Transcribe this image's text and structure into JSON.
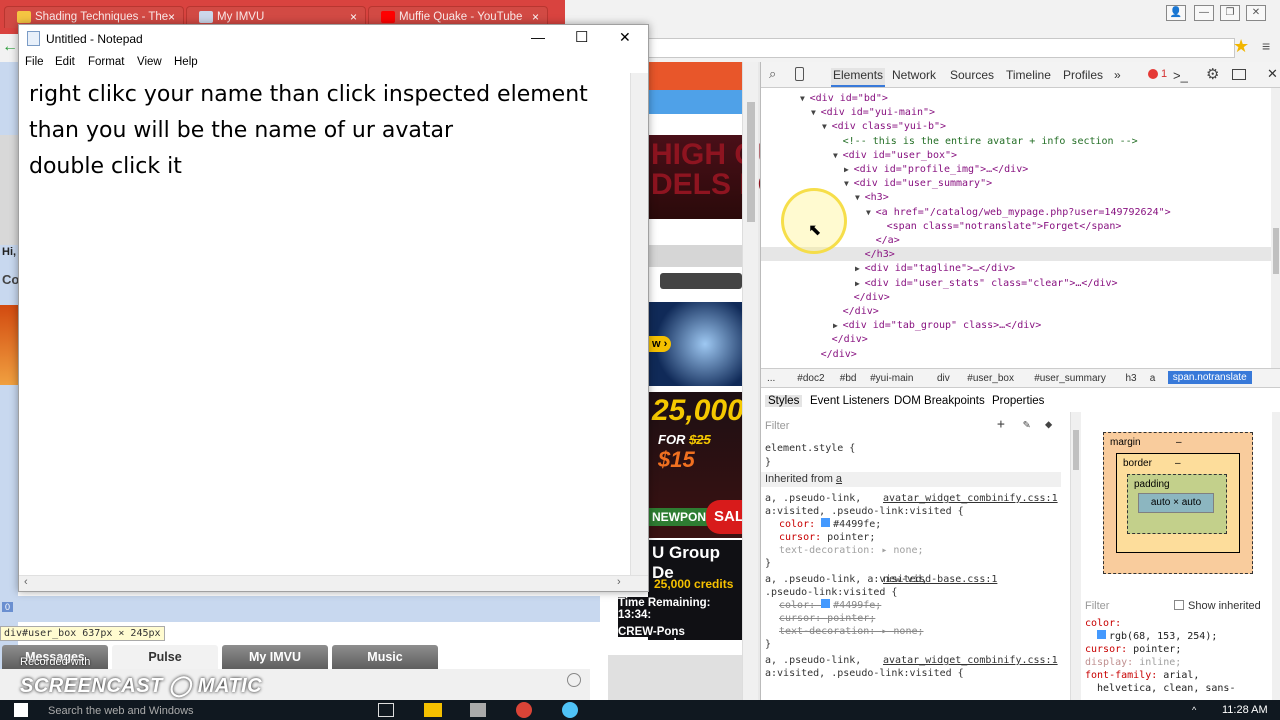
{
  "browser": {
    "tabs": [
      {
        "label": "Shading Techniques - The",
        "icon": "star-icon",
        "color": "#f5c542"
      },
      {
        "label": "My IMVU",
        "icon": "imvu-icon",
        "color": "#ccd7ea"
      },
      {
        "label": "Muffie Quake - YouTube",
        "icon": "youtube-icon",
        "color": "#ff0000"
      }
    ],
    "tab_close": "×",
    "win_controls": {
      "minimize": "—",
      "restore": "❐",
      "close": "✕"
    }
  },
  "notepad": {
    "title": "Untitled - Notepad",
    "menu": [
      "File",
      "Edit",
      "Format",
      "View",
      "Help"
    ],
    "lines": [
      "right clikc your name than click inspected element",
      "than you will be the name of ur avatar",
      "double click it"
    ],
    "controls": {
      "minimize": "—",
      "maximize": "☐",
      "close": "✕"
    }
  },
  "page": {
    "ad_text": "HIGH QU\nDELS FO",
    "ad_price_top": "25,000",
    "ad_price_for": "FOR",
    "ad_price_old": "$25",
    "ad_price_new": "$15",
    "newpon": "NEWPON",
    "sale": "SAL",
    "group_title": "U Group De",
    "credits": "25,000 credits",
    "time_remaining": "Time Remaining: 13:34:",
    "crew_pons": "CREW-Pons Purchased",
    "hi_text": "Hi,",
    "co_text": "Co",
    "far_text": "ar",
    "size_tooltip": "div#user_box  637px × 245px",
    "bottom_tabs": [
      "Messages",
      "Pulse",
      "My IMVU",
      "Music"
    ],
    "badge": "0"
  },
  "watermark": {
    "recorded": "Recorded with",
    "brand": "SCREENCAST ◯ MATIC"
  },
  "devtools": {
    "tabs": [
      "Elements",
      "Network",
      "Sources",
      "Timeline",
      "Profiles"
    ],
    "more": "»",
    "error_count": "1",
    "dom": [
      {
        "indent": 1,
        "arrow": "▼",
        "html": "<div id=\"bd\">"
      },
      {
        "indent": 2,
        "arrow": "▼",
        "html": "<div id=\"yui-main\">"
      },
      {
        "indent": 3,
        "arrow": "▼",
        "html": "<div class=\"yui-b\">"
      },
      {
        "indent": 4,
        "arrow": "",
        "html": "<!-- this is the entire avatar + info section -->"
      },
      {
        "indent": 4,
        "arrow": "▼",
        "html": "<div id=\"user_box\">"
      },
      {
        "indent": 5,
        "arrow": "▶",
        "html": "<div id=\"profile_img\">…</div>"
      },
      {
        "indent": 5,
        "arrow": "▼",
        "html": "<div id=\"user_summary\">"
      },
      {
        "indent": 6,
        "arrow": "▼",
        "html": "<h3>"
      },
      {
        "indent": 7,
        "arrow": "▼",
        "html": "<a href=\"/catalog/web_mypage.php?user=149792624\">"
      },
      {
        "indent": 8,
        "arrow": "",
        "html": "<span class=\"notranslate\">Forget</span>"
      },
      {
        "indent": 7,
        "arrow": "",
        "html": "</a>"
      },
      {
        "indent": 6,
        "arrow": "",
        "html": "</h3>"
      },
      {
        "indent": 6,
        "arrow": "▶",
        "html": "<div id=\"tagline\">…</div>"
      },
      {
        "indent": 6,
        "arrow": "▶",
        "html": "<div id=\"user_stats\" class=\"clear\">…</div>"
      },
      {
        "indent": 5,
        "arrow": "",
        "html": "</div>"
      },
      {
        "indent": 4,
        "arrow": "",
        "html": "</div>"
      },
      {
        "indent": 4,
        "arrow": "▶",
        "html": "<div id=\"tab_group\" class>…</div>"
      },
      {
        "indent": 3,
        "arrow": "",
        "html": "</div>"
      },
      {
        "indent": 2,
        "arrow": "",
        "html": "</div>"
      }
    ],
    "breadcrumbs": [
      "...",
      "#doc2",
      "#bd",
      "#yui-main",
      "div",
      "#user_box",
      "#user_summary",
      "h3",
      "a",
      "span.notranslate"
    ],
    "subtabs": [
      "Styles",
      "Event Listeners",
      "DOM Breakpoints",
      "Properties"
    ],
    "filter_placeholder": "Filter",
    "styles": {
      "element_style": "element.style {",
      "close": "}",
      "inherited": "Inherited from",
      "inherited_from": "a",
      "rules": [
        {
          "selector": "a, .pseudo-link,\na:visited, .pseudo-link:visited {",
          "source": "avatar_widget_combinify.css:1",
          "decls": [
            [
              "color:",
              "#4499fe;"
            ],
            [
              "cursor:",
              "pointer;"
            ],
            [
              "text-decoration:",
              "none;"
            ]
          ],
          "struck": false
        },
        {
          "selector": "a, .pseudo-link, a:visited,\n.pseudo-link:visited {",
          "source": "new-visd-base.css:1",
          "decls": [
            [
              "color:",
              "#4499fe;"
            ],
            [
              "cursor:",
              "pointer;"
            ],
            [
              "text-decoration:",
              "none;"
            ]
          ],
          "struck": true
        },
        {
          "selector": "a, .pseudo-link,\na:visited, .pseudo-link:visited {",
          "source": "avatar_widget_combinify.css:1",
          "decls": [],
          "struck": false
        }
      ]
    },
    "boxmodel": {
      "margin": "margin",
      "border": "border",
      "padding": "padding",
      "content": "auto × auto",
      "dash": "–"
    },
    "computed": {
      "filter": "Filter",
      "show_inherited": "Show inherited",
      "lines": [
        [
          "color:",
          ""
        ],
        [
          "",
          "rgb(68, 153, 254);"
        ],
        [
          "cursor:",
          "pointer;"
        ],
        [
          "display:",
          "inline;"
        ],
        [
          "font-family:",
          "arial,"
        ],
        [
          "",
          "helvetica, clean, sans-"
        ]
      ]
    }
  },
  "taskbar": {
    "search": "Search the web and Windows",
    "time": "11:28 AM"
  },
  "colors": {
    "tab_bar": "#d9433f",
    "selected_crumb": "#3879d9",
    "swatch": "#4499fe"
  }
}
